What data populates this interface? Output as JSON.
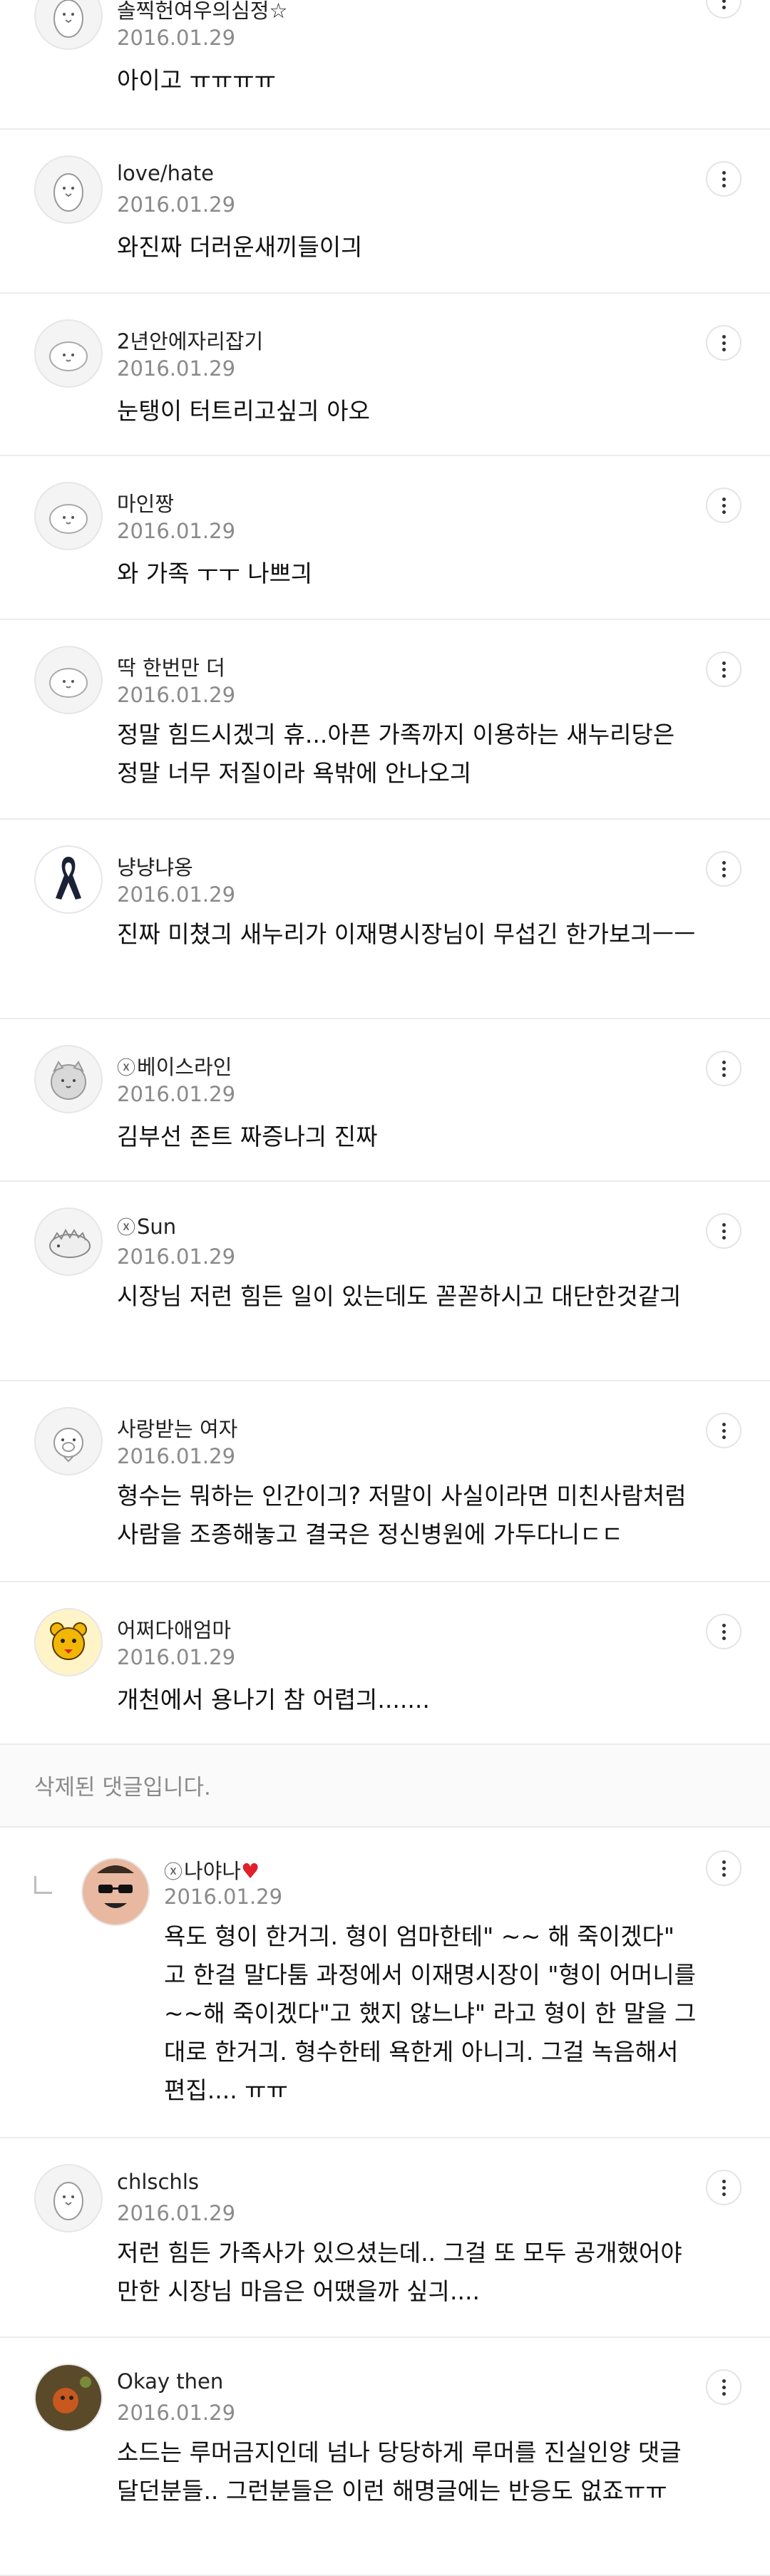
{
  "more_label": "⋮",
  "reply_marker": "↳",
  "deleted_text": "삭제된 댓글입니다.",
  "comments": [
    {
      "nick": "솔찍헌여우의심정☆",
      "date": "2016.01.29",
      "body": "아이고 ㅠㅠㅠㅠ",
      "avatar": "ghost-bird"
    },
    {
      "nick": "love/hate",
      "date": "2016.01.29",
      "body": "와진짜 더러운새끼들이긔",
      "avatar": "ghost-bird"
    },
    {
      "nick": "2년안에자리잡기",
      "date": "2016.01.29",
      "body": "눈탱이 터트리고싶긔 아오",
      "avatar": "blob"
    },
    {
      "nick": "마인짱",
      "date": "2016.01.29",
      "body": "와 가족 ㅜㅜ 나쁘긔",
      "avatar": "blob"
    },
    {
      "nick": "딱 한번만 더",
      "date": "2016.01.29",
      "body": "정말 힘드시겠긔 휴...아픈 가족까지 이용하는 새누리당은 정말 너무 저질이라 욕밖에 안나오긔",
      "avatar": "blob"
    },
    {
      "nick": "냥냥냐옹",
      "date": "2016.01.29",
      "body": "진짜 미쳤긔 새누리가 이재명시장님이 무섭긴 한가보긔ㅡㅡ",
      "avatar": "ribbon"
    },
    {
      "nick": "베이스라인",
      "nick_badge": "ⓧ",
      "date": "2016.01.29",
      "body": "김부선 존트 짜증나긔 진짜",
      "avatar": "cat"
    },
    {
      "nick": "Sun",
      "nick_badge": "ⓧ",
      "date": "2016.01.29",
      "body": "시장님 저런 힘든 일이 있는데도 꼳꼳하시고 대단한것같긔",
      "avatar": "hedgehog"
    },
    {
      "nick": "사랑받는 여자",
      "date": "2016.01.29",
      "body": "형수는 뭐하는 인간이긔? 저말이 사실이라면 미친사람처럼 사람을 조종해놓고 결국은 정신병원에 가두다니ㄷㄷ",
      "avatar": "pig"
    },
    {
      "nick": "어쩌다애엄마",
      "date": "2016.01.29",
      "body": "개천에서 용나기 참 어렵긔.......",
      "avatar": "bear"
    }
  ],
  "reply": {
    "nick": "나야나",
    "nick_badge": "ⓧ",
    "heart": "♥",
    "date": "2016.01.29",
    "body": "욕도 형이 한거긔. 형이 엄마한테\" ~~ 해 죽이겠다\" 고 한걸 말다툼 과정에서 이재명시장이 \"형이 어머니를~~해 죽이겠다\"고 했지 않느냐\" 라고 형이 한 말을 그대로 한거긔. 형수한테 욕한게 아니긔. 그걸 녹음해서 편집.... ㅠㅠ",
    "avatar": "man"
  },
  "comments2": [
    {
      "nick": "chlschls",
      "date": "2016.01.29",
      "body": "저런 힘든 가족사가 있으셨는데.. 그걸 또 모두 공개했어야만한 시장님 마음은 어땠을까 싶긔....",
      "avatar": "ghost-bird"
    },
    {
      "nick": "Okay then",
      "date": "2016.01.29",
      "body": "소드는 루머금지인데 넘나 당당하게 루머를 진실인양 댓글달던분들.. 그런분들은 이런 해명글에는 반응도 없죠ㅠㅠ",
      "avatar": "photo"
    }
  ]
}
